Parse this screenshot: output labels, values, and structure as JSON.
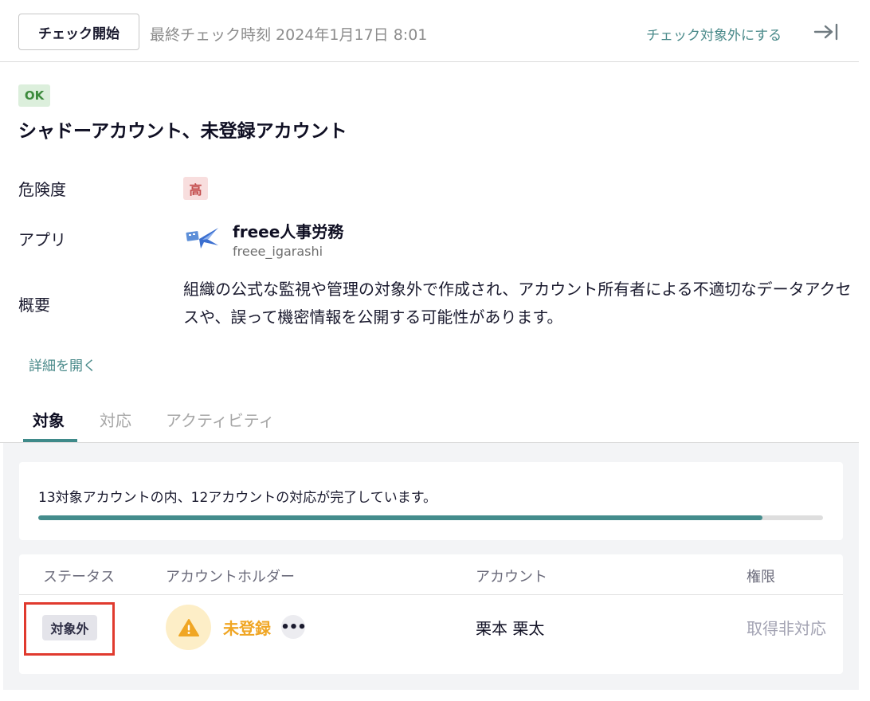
{
  "topbar": {
    "start_button": "チェック開始",
    "last_check": "最終チェック時刻 2024年1月17日 8:01",
    "exclude_link": "チェック対象外にする"
  },
  "header": {
    "status_badge": "OK",
    "title": "シャドーアカウント、未登録アカウント"
  },
  "fields": {
    "risk_label": "危険度",
    "risk_value": "高",
    "app_label": "アプリ",
    "app_name": "freee人事労務",
    "app_account": "freee_igarashi",
    "summary_label": "概要",
    "summary_text": "組織の公式な監視や管理の対象外で作成され、アカウント所有者による不適切なデータアクセスや、誤って機密情報を公開する可能性があります。"
  },
  "details_link": "詳細を開く",
  "tabs": [
    {
      "label": "対象",
      "active": true
    },
    {
      "label": "対応",
      "active": false
    },
    {
      "label": "アクティビティ",
      "active": false
    }
  ],
  "progress": {
    "text": "13対象アカウントの内、12アカウントの対応が完了しています。",
    "completed": 12,
    "total": 13,
    "color": "#448c8c"
  },
  "table": {
    "headers": {
      "status": "ステータス",
      "holder": "アカウントホルダー",
      "account": "アカウント",
      "permission": "権限"
    },
    "rows": [
      {
        "status": "対象外",
        "holder": "未登録",
        "holder_icon": "warning-icon",
        "more": "•••",
        "account": "栗本 栗太",
        "permission": "取得非対応"
      }
    ]
  },
  "colors": {
    "accent": "#448c8c",
    "warning": "#f0a624",
    "danger": "#c34c4c",
    "highlight": "#e03a2e"
  }
}
